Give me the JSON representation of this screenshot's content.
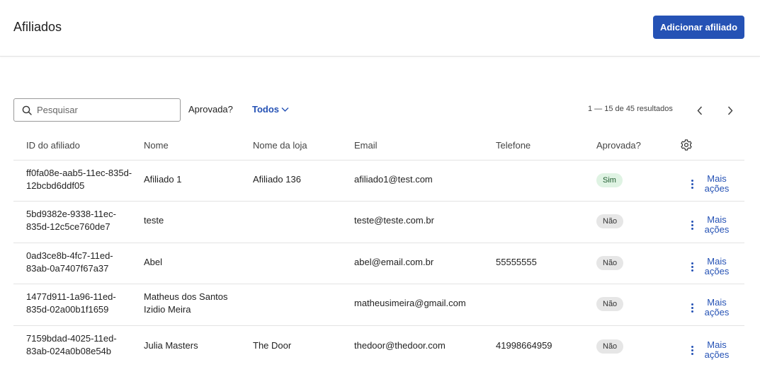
{
  "header": {
    "title": "Afiliados",
    "add_button": "Adicionar afiliado",
    "accent": "#2552b5"
  },
  "toolbar": {
    "search_placeholder": "Pesquisar",
    "filter_label": "Aprovada?",
    "filter_value": "Todos",
    "results_text": "1 — 15 de 45 resultados"
  },
  "table": {
    "columns": [
      "ID do afiliado",
      "Nome",
      "Nome da loja",
      "Email",
      "Telefone",
      "Aprovada?"
    ],
    "rows": [
      {
        "id": "ff0fa08e-aab5-11ec-835d-12bcbd6ddf05",
        "name": "Afiliado 1",
        "store": "Afiliado 136",
        "email": "afiliado1@test.com",
        "phone": "",
        "approved": "Sim",
        "more": "Mais ações"
      },
      {
        "id": "5bd9382e-9338-11ec-835d-12c5ce760de7",
        "name": "teste",
        "store": "",
        "email": "teste@teste.com.br",
        "phone": "",
        "approved": "Não",
        "more": "Mais ações"
      },
      {
        "id": "0ad3ce8b-4fc7-11ed-83ab-0a7407f67a37",
        "name": "Abel",
        "store": "",
        "email": "abel@email.com.br",
        "phone": "55555555",
        "approved": "Não",
        "more": "Mais ações"
      },
      {
        "id": "1477d911-1a96-11ed-835d-02a00b1f1659",
        "name": "Matheus dos Santos Izidio Meira",
        "store": "",
        "email": "matheusimeira@gmail.com",
        "phone": "",
        "approved": "Não",
        "more": "Mais ações"
      },
      {
        "id": "7159bdad-4025-11ed-83ab-024a0b08e54b",
        "name": "Julia Masters",
        "store": "The Door",
        "email": "thedoor@thedoor.com",
        "phone": "41998664959",
        "approved": "Não",
        "more": "Mais ações"
      }
    ]
  },
  "colors": {
    "approved_yes_bg": "#dff3e3",
    "approved_no_bg": "#e6e6e6"
  }
}
